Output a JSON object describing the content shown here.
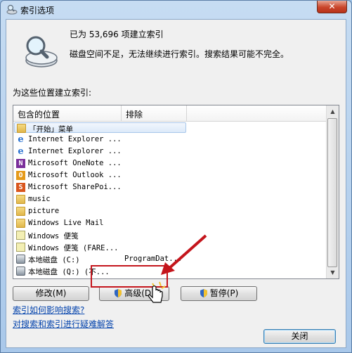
{
  "window": {
    "title": "索引选项",
    "close_glyph": "✕"
  },
  "summary": {
    "count_line": "已为 53,696 项建立索引",
    "warning": "磁盘空间不足，无法继续进行索引。搜索结果可能不完全。"
  },
  "locations_label": "为这些位置建立索引:",
  "table": {
    "columns": [
      "包含的位置",
      "排除"
    ],
    "rows": [
      {
        "icon": "folder-icon",
        "name": "「开始」菜单",
        "exclude": "",
        "selected": true
      },
      {
        "icon": "ie-icon",
        "name": "Internet Explorer ...",
        "exclude": ""
      },
      {
        "icon": "ie-icon",
        "name": "Internet Explorer ...",
        "exclude": ""
      },
      {
        "icon": "onenote-icon",
        "name": "Microsoft OneNote ...",
        "exclude": ""
      },
      {
        "icon": "outlook-icon",
        "name": "Microsoft Outlook ...",
        "exclude": ""
      },
      {
        "icon": "sharepoint-icon",
        "name": "Microsoft SharePoi...",
        "exclude": ""
      },
      {
        "icon": "folder-icon",
        "name": "music",
        "exclude": ""
      },
      {
        "icon": "folder-icon",
        "name": "picture",
        "exclude": ""
      },
      {
        "icon": "folder-icon",
        "name": "Windows Live Mail",
        "exclude": ""
      },
      {
        "icon": "note-icon",
        "name": "Windows 便笺",
        "exclude": ""
      },
      {
        "icon": "note-icon",
        "name": "Windows 便笺 (FARE...",
        "exclude": ""
      },
      {
        "icon": "drive-icon",
        "name": "本地磁盘 (C:)",
        "exclude": "ProgramDat..."
      },
      {
        "icon": "drive-icon",
        "name": "本地磁盘 (Q:) (不...",
        "exclude": ""
      }
    ]
  },
  "buttons": {
    "modify": "修改(M)",
    "advanced": "高级(D)",
    "pause": "暂停(P)",
    "close": "关闭"
  },
  "links": {
    "how_affect": "索引如何影响搜索?",
    "troubleshoot": "对搜索和索引进行疑难解答"
  },
  "colors": {
    "annotation_red": "#c4151c",
    "link_blue": "#0645ad"
  }
}
